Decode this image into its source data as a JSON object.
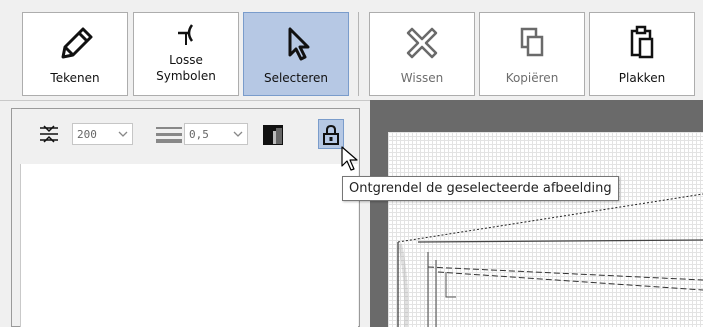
{
  "toolbar": {
    "tekenen": "Tekenen",
    "losse_line1": "Losse",
    "losse_line2": "Symbolen",
    "selecteren": "Selecteren",
    "wissen": "Wissen",
    "kopieren": "Kopiëren",
    "plakken": "Plakken"
  },
  "props": {
    "width_value": "200",
    "thickness_value": "0,5"
  },
  "tooltip": {
    "text": "Ontgrendel de geselecteerde afbeelding"
  },
  "colors": {
    "active_button": "#b6c8e4",
    "canvas_bg": "#6a6a6a"
  },
  "icons": [
    "pencil-icon",
    "symbol-icon",
    "arrow-cursor-icon",
    "erase-x-icon",
    "copy-icon",
    "paste-icon",
    "width-icon",
    "line-thickness-icon",
    "color-swatch-icon",
    "lock-icon"
  ]
}
